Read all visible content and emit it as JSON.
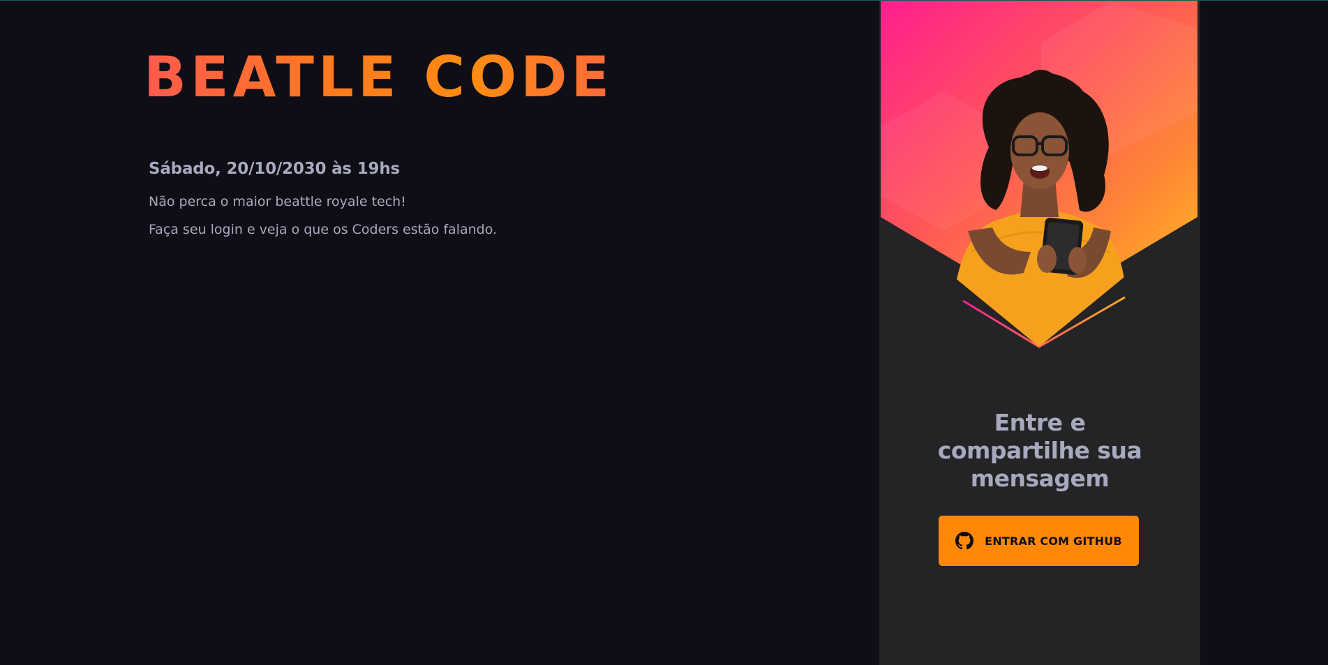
{
  "brand": {
    "logo_text": "BEATLE CODE"
  },
  "event": {
    "date_text": "Sábado, 20/10/2030 às 19hs",
    "lines": [
      "Não perca o maior beattle royale tech!",
      "Faça seu login e veja o que os Coders estão falando."
    ]
  },
  "login_panel": {
    "title_lines": [
      "Entre e",
      "compartilhe sua",
      "mensagem"
    ],
    "button_label": "ENTRAR COM GITHUB",
    "button_icon": "github-icon",
    "banner_image": "woman-with-phone-photo"
  },
  "colors": {
    "background": "#0f0e17",
    "panel": "#242325",
    "accent": "#ff8906",
    "text_muted": "#a7a9be",
    "gradient_start": "#ff1f8e",
    "gradient_end": "#ffb11f"
  }
}
